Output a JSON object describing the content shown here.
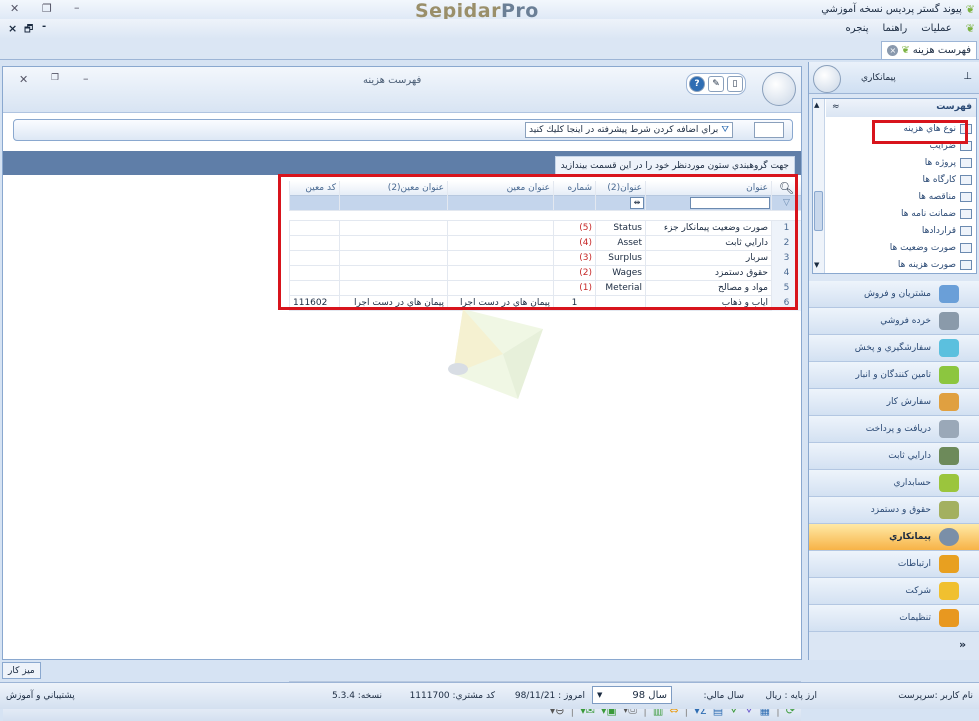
{
  "window": {
    "app_title": "پیوند گستر پردیس نسخه آموزشي",
    "logo_part1": "Sepidar",
    "logo_part2": "Pro"
  },
  "menu": {
    "items": [
      "عمليات",
      "راهنما",
      "پنجره"
    ]
  },
  "doc_tab": {
    "label": "فهرست هزينه"
  },
  "main_panel": {
    "title": "فهرست هزينه",
    "filter_button": "براي اضافه كردن شرط پيشرفته در اينجا كليك كنيد",
    "group_hint": "جهت گروهبندي ستون موردنظر خود را در اين قسمت بيندازيد",
    "group_dots": "\"''''''''''' \""
  },
  "grid": {
    "columns": [
      "عنوان",
      "عنوان(2)",
      "شماره",
      "عنوان معين",
      "عنوان معين(2)",
      "کد معين"
    ],
    "rows": [
      {
        "n": "1",
        "c1": "صورت وضعيت پيمانكار جزء",
        "c2": "Status",
        "c3": "(5)",
        "c4": "",
        "c5": "",
        "c6": ""
      },
      {
        "n": "2",
        "c1": "دارايي ثابت",
        "c2": "Asset",
        "c3": "(4)",
        "c4": "",
        "c5": "",
        "c6": ""
      },
      {
        "n": "3",
        "c1": "سربار",
        "c2": "Surplus",
        "c3": "(3)",
        "c4": "",
        "c5": "",
        "c6": ""
      },
      {
        "n": "4",
        "c1": "حقوق دستمزد",
        "c2": "Wages",
        "c3": "(2)",
        "c4": "",
        "c5": "",
        "c6": ""
      },
      {
        "n": "5",
        "c1": "مواد و مصالح",
        "c2": "Meterial",
        "c3": "(1)",
        "c4": "",
        "c5": "",
        "c6": ""
      },
      {
        "n": "6",
        "c1": "اياب و ذهاب",
        "c2": "",
        "c3": "1",
        "c4": "پيمان هاي در دست اجرا",
        "c5": "پيمان هاي در دست اجرا",
        "c6": "111602"
      }
    ],
    "sum_symbol": "Σ"
  },
  "sidebar": {
    "title": "پيمانكاري",
    "tree_header": "فهرست",
    "tree_items": [
      "نوع هاي هزينه",
      "ضرايب",
      "پروژه ها",
      "کارگاه ها",
      "مناقصه ها",
      "ضمانت نامه ها",
      "قراردادها",
      "صورت وضعيت ها",
      "صورت هزينه ها"
    ],
    "nav_items": [
      {
        "label": "مشتريان و فروش",
        "color": "#6a9fd8"
      },
      {
        "label": "خرده فروشي",
        "color": "#8a9aaa"
      },
      {
        "label": "سفارشگيري و پخش",
        "color": "#5bc0de"
      },
      {
        "label": "تامين كنندگان و انبار",
        "color": "#8cc63f"
      },
      {
        "label": "سفارش كار",
        "color": "#e0a040"
      },
      {
        "label": "دريافت و پرداخت",
        "color": "#9aa8b8"
      },
      {
        "label": "دارايي ثابت",
        "color": "#6d8a5a"
      },
      {
        "label": "حسابداري",
        "color": "#9bc53d"
      },
      {
        "label": "حقوق و دستمزد",
        "color": "#a3b060"
      },
      {
        "label": "پيمانكاري",
        "color": "#7a8fa8"
      },
      {
        "label": "ارتباطات",
        "color": "#e8a020"
      },
      {
        "label": "شركت",
        "color": "#f0c030"
      },
      {
        "label": "تنظيمات",
        "color": "#e89820"
      }
    ],
    "more": "»"
  },
  "footer": {
    "desk_tab": "ميز كار",
    "user": "نام كاربر :سرپرست",
    "base_currency": "ارز پايه :  ريال",
    "fiscal_year_label": "سال مالي:",
    "fiscal_year_value": "سال 98",
    "today": "امروز :  98/11/21",
    "customer_code": "كد مشتري:  1111700",
    "version": "نسخه:  5.3.4",
    "support": "پشتيباني و آموزش"
  }
}
